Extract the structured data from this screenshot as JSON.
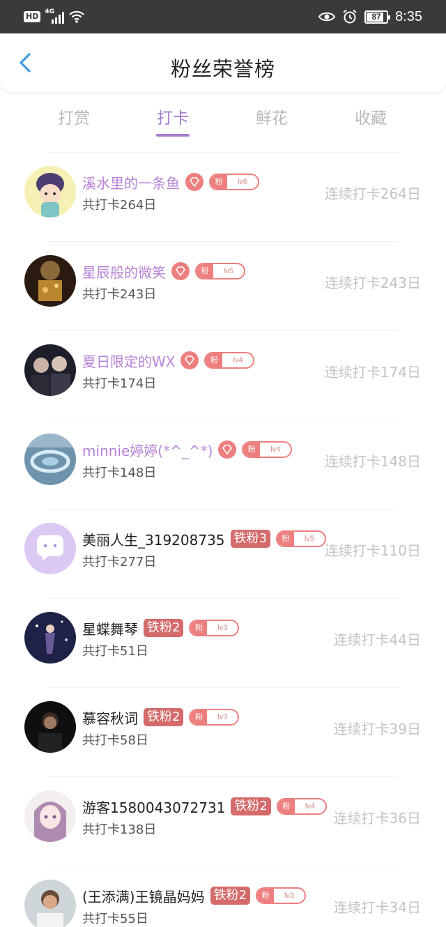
{
  "status_bar": {
    "hd": "HD",
    "network": "4G",
    "battery": "87",
    "time": "8:35"
  },
  "header": {
    "title": "粉丝荣誉榜"
  },
  "tabs": [
    {
      "label": "打赏",
      "active": false
    },
    {
      "label": "打卡",
      "active": true
    },
    {
      "label": "鲜花",
      "active": false
    },
    {
      "label": "收藏",
      "active": false
    }
  ],
  "fan_badge_label": "粉",
  "rows": [
    {
      "name": "溪水里的一条鱼",
      "vip": true,
      "iron": "",
      "level": "lv6",
      "total": "共打卡264日",
      "streak": "连续打卡264日"
    },
    {
      "name": "星辰般的微笑",
      "vip": true,
      "iron": "",
      "level": "lv5",
      "total": "共打卡243日",
      "streak": "连续打卡243日"
    },
    {
      "name": "夏日限定的WX",
      "vip": true,
      "iron": "",
      "level": "lv4",
      "total": "共打卡174日",
      "streak": "连续打卡174日"
    },
    {
      "name": "minnie婷婷(*^_^*)",
      "vip": true,
      "iron": "",
      "level": "lv4",
      "total": "共打卡148日",
      "streak": "连续打卡148日"
    },
    {
      "name": "美丽人生_319208735",
      "vip": false,
      "iron": "铁粉3",
      "level": "lv5",
      "total": "共打卡277日",
      "streak": "连续打卡110日"
    },
    {
      "name": "星蝶舞琴",
      "vip": false,
      "iron": "铁粉2",
      "level": "lv3",
      "total": "共打卡51日",
      "streak": "连续打卡44日"
    },
    {
      "name": "慕容秋词",
      "vip": false,
      "iron": "铁粉2",
      "level": "lv3",
      "total": "共打卡58日",
      "streak": "连续打卡39日"
    },
    {
      "name": "游客1580043072731",
      "vip": false,
      "iron": "铁粉2",
      "level": "lv4",
      "total": "共打卡138日",
      "streak": "连续打卡36日"
    },
    {
      "name": "(王添满)王镜晶妈妈",
      "vip": false,
      "iron": "铁粉2",
      "level": "lv3",
      "total": "共打卡55日",
      "streak": "连续打卡34日"
    }
  ],
  "colors": {
    "accent": "#a57ccf",
    "vip_name": "#b682d6",
    "fan_badge": "#ee7f7f",
    "iron_badge": "#d46a6a"
  }
}
